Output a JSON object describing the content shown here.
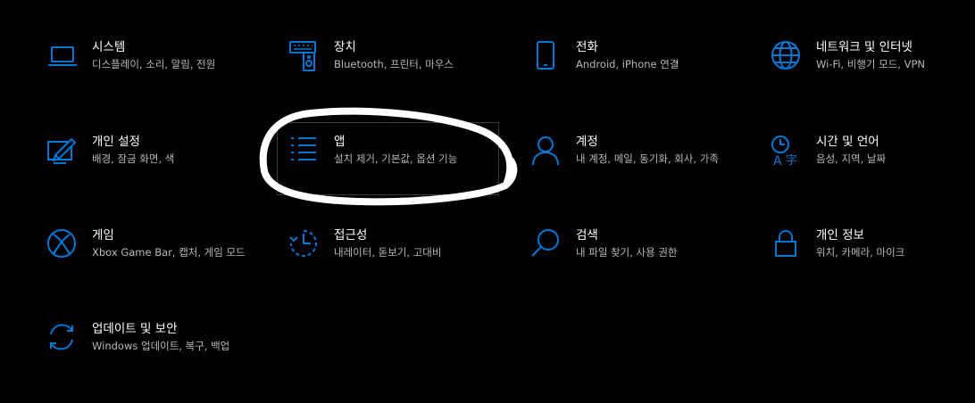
{
  "colors": {
    "accent": "#0078d7",
    "background": "#000000",
    "title": "#ffffff",
    "description": "#b8b8b8"
  },
  "tiles": [
    {
      "title": "시스템",
      "desc": "디스플레이, 소리, 알림, 전원",
      "icon": "laptop-icon"
    },
    {
      "title": "장치",
      "desc": "Bluetooth, 프린터, 마우스",
      "icon": "devices-icon"
    },
    {
      "title": "전화",
      "desc": "Android, iPhone 연결",
      "icon": "phone-icon"
    },
    {
      "title": "네트워크 및 인터넷",
      "desc": "Wi-Fi, 비행기 모드, VPN",
      "icon": "globe-icon"
    },
    {
      "title": "개인 설정",
      "desc": "배경, 잠금 화면, 색",
      "icon": "personalization-icon"
    },
    {
      "title": "앱",
      "desc": "설치 제거, 기본값, 옵션 기능",
      "icon": "apps-list-icon"
    },
    {
      "title": "계정",
      "desc": "내 계정, 메일, 동기화, 회사, 가족",
      "icon": "person-icon"
    },
    {
      "title": "시간 및 언어",
      "desc": "음성, 지역, 날짜",
      "icon": "time-language-icon"
    },
    {
      "title": "게임",
      "desc": "Xbox Game Bar, 캡처, 게임 모드",
      "icon": "xbox-icon"
    },
    {
      "title": "접근성",
      "desc": "내레이터, 돋보기, 고대비",
      "icon": "ease-of-access-icon"
    },
    {
      "title": "검색",
      "desc": "내 파일 찾기, 사용 권한",
      "icon": "search-icon"
    },
    {
      "title": "개인 정보",
      "desc": "위치, 카메라, 마이크",
      "icon": "lock-icon"
    },
    {
      "title": "업데이트 및 보안",
      "desc": "Windows 업데이트, 복구, 백업",
      "icon": "sync-icon"
    }
  ]
}
